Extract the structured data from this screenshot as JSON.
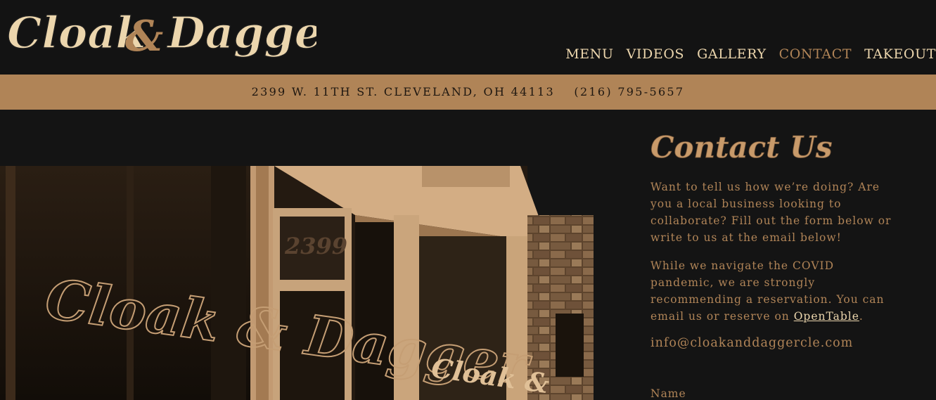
{
  "brand": {
    "logo_text": "Cloak & Dagger",
    "colors": {
      "cream": "#ecd6ad",
      "bronze": "#b08457",
      "background": "#131313"
    }
  },
  "nav": {
    "items": [
      {
        "label": "MENU"
      },
      {
        "label": "VIDEOS"
      },
      {
        "label": "GALLERY"
      },
      {
        "label": "CONTACT"
      },
      {
        "label": "TAKEOUT"
      }
    ]
  },
  "address_bar": {
    "address": "2399 W. 11TH ST. CLEVELAND, OH 44113",
    "phone": "(216) 795-5657"
  },
  "photo": {
    "window_text": "Cloak & Dagger",
    "small_window_text": "Cloak &",
    "street_number": "2399"
  },
  "contact": {
    "title": "Contact Us",
    "para1": "Want to tell us how we’re doing? Are you a local business looking to collaborate? Fill out the form below or write to us at the email below!",
    "para2_prefix": "While we navigate the COVID pandemic, we are strongly recommending a reservation. You can email us or reserve on ",
    "opentable_label": "OpenTable",
    "para2_suffix": ".",
    "email": "info@cloakanddaggercle.com",
    "name_label": "Name"
  }
}
